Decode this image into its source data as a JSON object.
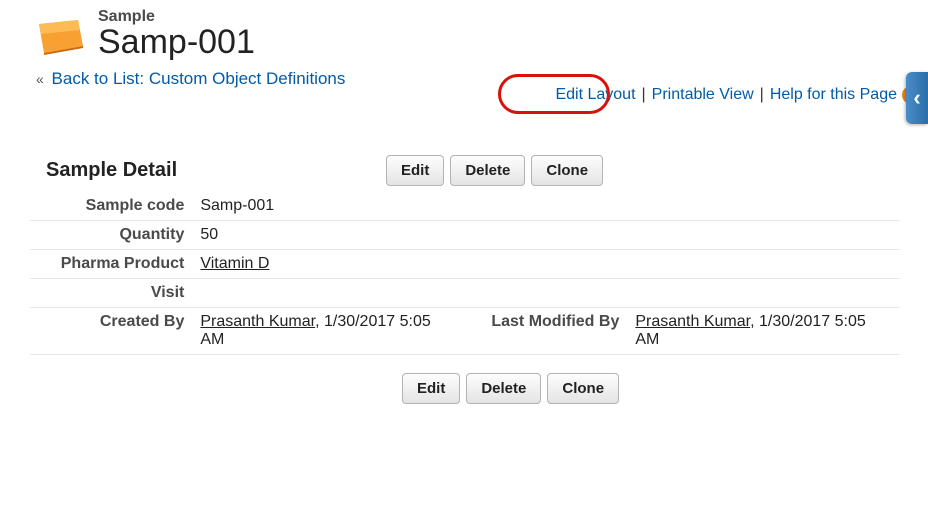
{
  "breadcrumb": {
    "label": "Sample"
  },
  "page_title": "Samp-001",
  "back_link": {
    "caret": "«",
    "text": "Back to List: Custom Object Definitions"
  },
  "links": {
    "edit_layout": "Edit Layout",
    "printable_view": "Printable View",
    "help": "Help for this Page",
    "sep": "|"
  },
  "section_title": "Sample Detail",
  "buttons": {
    "edit": "Edit",
    "delete": "Delete",
    "clone": "Clone"
  },
  "fields": {
    "sample_code": {
      "label": "Sample code",
      "value": "Samp-001"
    },
    "quantity": {
      "label": "Quantity",
      "value": "50"
    },
    "pharma_product": {
      "label": "Pharma Product",
      "value": "Vitamin D"
    },
    "visit": {
      "label": "Visit",
      "value": ""
    },
    "created_by": {
      "label": "Created By",
      "user": "Prasanth Kumar",
      "datetime": ", 1/30/2017 5:05 AM"
    },
    "last_modified_by": {
      "label": "Last Modified By",
      "user": "Prasanth Kumar",
      "datetime": ", 1/30/2017 5:05 AM"
    }
  },
  "help_icon_char": "?",
  "side_arrow": "‹"
}
